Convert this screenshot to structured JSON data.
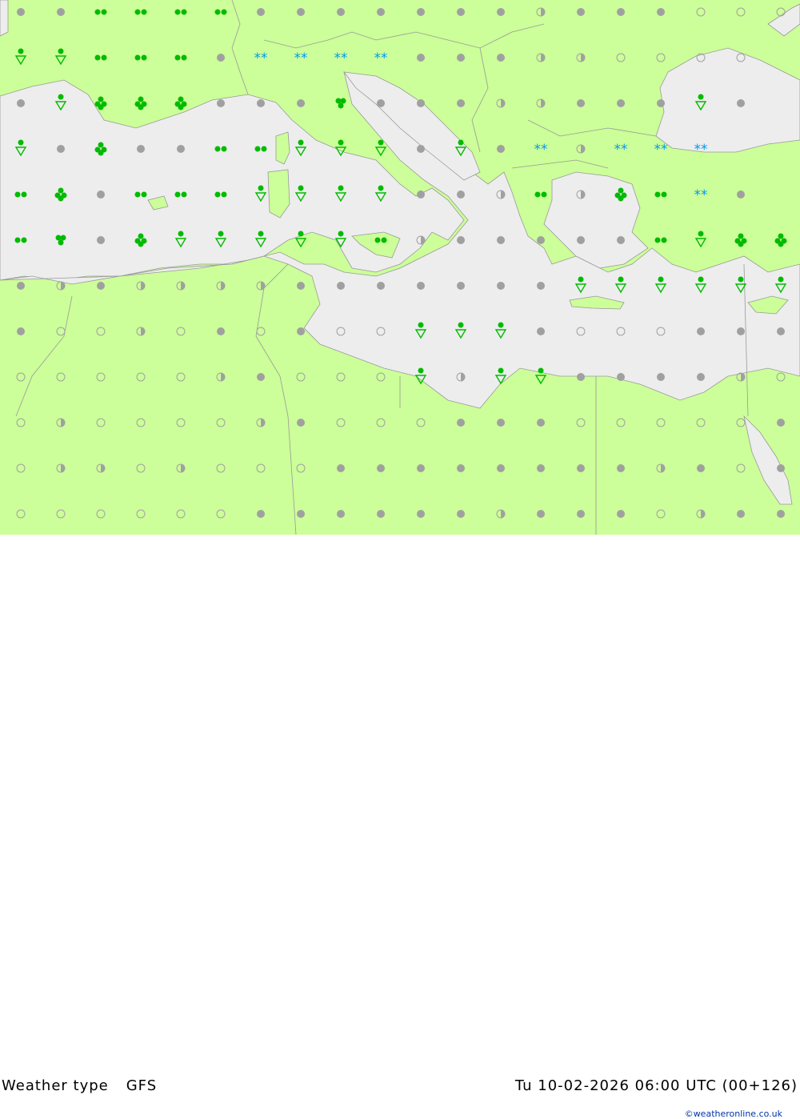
{
  "map": {
    "product_label": "Weather type",
    "model_label": "GFS",
    "valid_time": "Tu 10-02-2026 06:00 UTC (00+126)",
    "credit": "©weatheronline.co.uk",
    "colors": {
      "land": "#ccff99",
      "sea": "#ededed",
      "border": "#999999",
      "rain": "#00bb00",
      "snow": "#0099ee",
      "cloud": "#a0a0a0"
    },
    "symbol_grid": {
      "columns": 20,
      "rows": 12,
      "legend_codes": {
        "c": "overcast",
        "h": "partly cloudy",
        "o": "clear",
        "d": "drizzle",
        "r": "rain",
        "R": "heavy rain",
        "s": "rain showers",
        "S": "snow showers",
        "n": "snow",
        "N": "snow and rain"
      },
      "rows_codes": [
        "cc dddd cc cccc ch cc c ooo",
        "SSd dd cnnnn ccchh oo oo",
        "cSRRRc cc r ccchh cccS c",
        "ScRcc dd SSSc ScnhN nN",
        "dRcdddSSSSc chdhRdnc",
        "drcRSSSSSdhcccccdSRRnd",
        "chchhhhcccccccSSSSSS",
        "coohococooSSScoooccc",
        "ooooohcoooShSSccccho",
        "ohoooohcooocccoooooc",
        "ohhohooocccccccchcoc",
        "oooooocccccchcccohcc"
      ]
    }
  }
}
